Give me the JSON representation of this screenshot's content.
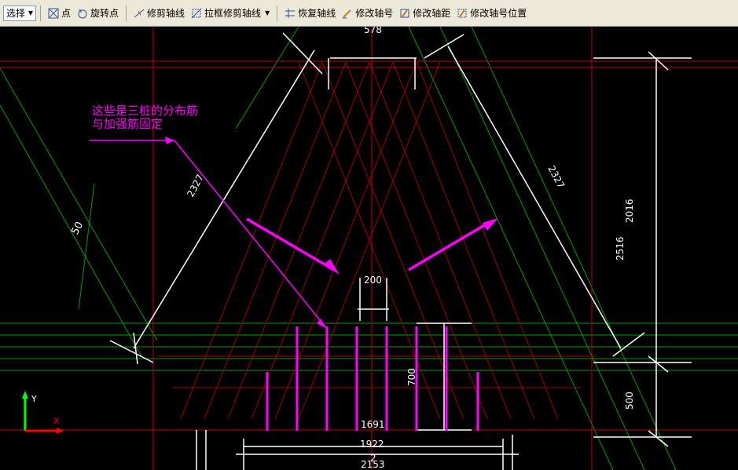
{
  "toolbar": {
    "select_label": "选择",
    "point_label": "点",
    "rotate_point_label": "旋转点",
    "trim_axis_label": "修剪轴线",
    "box_trim_axis_label": "拉框修剪轴线",
    "restore_axis_label": "恢复轴线",
    "edit_axis_no_label": "修改轴号",
    "edit_axis_dist_label": "修改轴距",
    "edit_axis_no_pos_label": "修改轴号位置"
  },
  "canvas": {
    "annotation_line1": "这些是三桩的分布筋",
    "annotation_line2": "与加强筋固定",
    "dim_top": "578",
    "dim_left_side": "2327",
    "dim_right_side": "2327",
    "dim_right_total": "2516",
    "dim_right_upper": "2016",
    "dim_right_lower": "500",
    "dim_center_gap": "200",
    "dim_center_height": "700",
    "dim_bottom_1": "1691",
    "dim_bottom_2": "1922",
    "dim_bottom_3": "2153",
    "dim_bottom_small": "2",
    "dim_diagonal_left": "50",
    "axis_y_label": "Y",
    "axis_x_label": "X"
  },
  "colors": {
    "background": "#000000",
    "magenta": "#ff00ff",
    "red_line": "#c80000",
    "green_line": "#00a000",
    "white_line": "#ffffff"
  }
}
